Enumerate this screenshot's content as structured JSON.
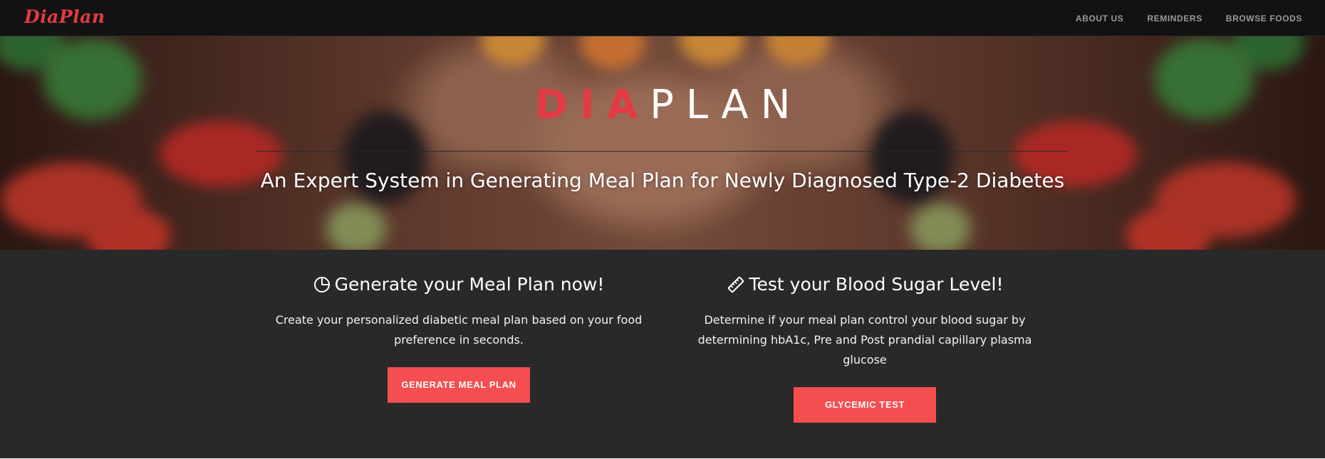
{
  "navbar": {
    "brand": "DiaPlan",
    "links": [
      {
        "label": "ABOUT US"
      },
      {
        "label": "REMINDERS"
      },
      {
        "label": "BROWSE FOODS"
      }
    ]
  },
  "hero": {
    "title_accent": "DIA",
    "title_rest": "PLAN",
    "subtitle": "An Expert System in Generating Meal Plan for Newly Diagnosed Type-2 Diabetes"
  },
  "services": [
    {
      "icon": "pie-chart-icon",
      "heading": "Generate your Meal Plan now!",
      "text": "Create your personalized diabetic meal plan based on your food preference in seconds.",
      "button": "GENERATE MEAL PLAN"
    },
    {
      "icon": "ruler-icon",
      "heading": "Test your Blood Sugar Level!",
      "text": "Determine if your meal plan control your blood sugar by determining hbA1c, Pre and Post prandial capillary plasma glucose",
      "button": "GLYCEMIC TEST"
    }
  ],
  "colors": {
    "accent": "#e23b43",
    "button": "#f44e50",
    "navbar_bg": "#121212",
    "section_bg": "#292929"
  }
}
